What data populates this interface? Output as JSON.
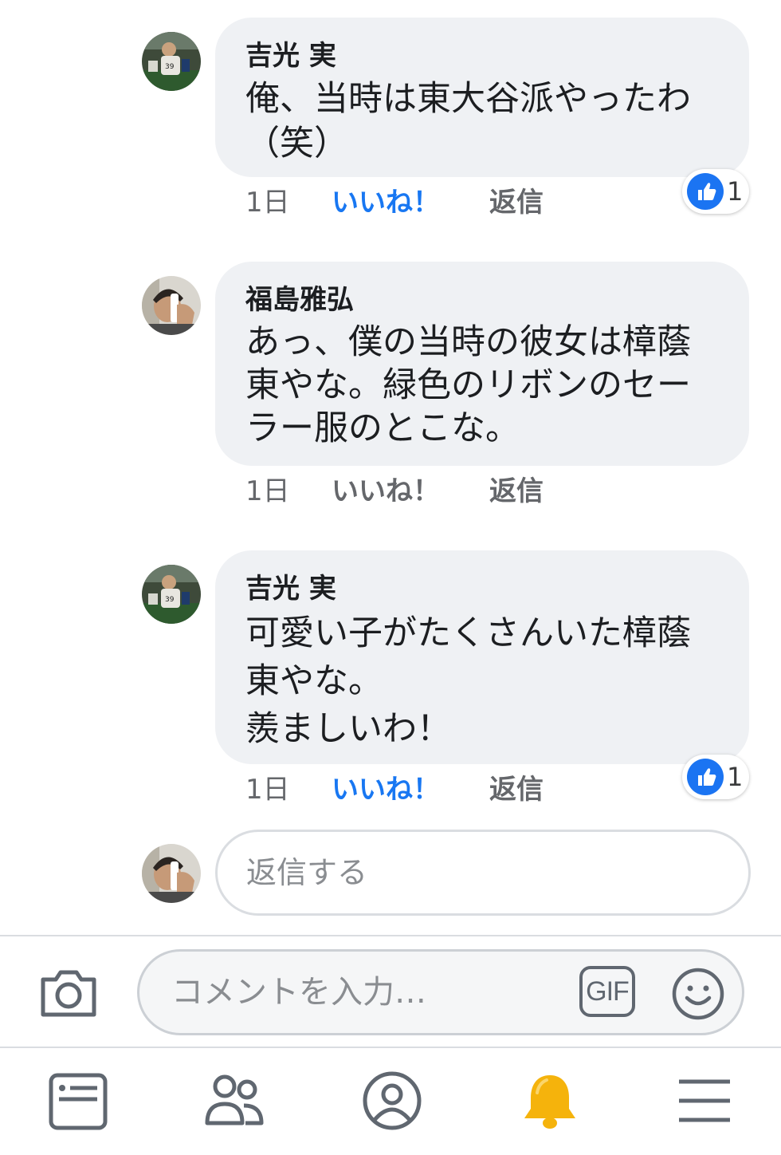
{
  "comments": [
    {
      "author": "吉光 実",
      "lines": [
        "俺、当時は東大谷派やったわ",
        "（笑）"
      ],
      "time": "1日",
      "like_label": "いいね！",
      "reply_label": "返信",
      "liked": true,
      "reaction_count": "1"
    },
    {
      "author": "福島雅弘",
      "lines": [
        "あっ、僕の当時の彼女は樟蔭",
        "東やな。緑色のリボンのセー",
        "ラー服のとこな。"
      ],
      "time": "1日",
      "like_label": "いいね！",
      "reply_label": "返信",
      "liked": false
    },
    {
      "author": "吉光 実",
      "lines": [
        "可愛い子がたくさんいた樟蔭",
        "東やな。",
        "羨ましいわ！"
      ],
      "time": "1日",
      "like_label": "いいね！",
      "reply_label": "返信",
      "liked": true,
      "reaction_count": "1"
    }
  ],
  "reply_box": {
    "placeholder": "返信する"
  },
  "comment_bar": {
    "placeholder": "コメントを入力…",
    "gif_label": "GIF",
    "camera_icon": "camera-icon",
    "emoji_icon": "smiley-icon"
  },
  "bottom_nav": {
    "items": [
      "news-feed-icon",
      "friends-icon",
      "profile-icon",
      "notifications-bell-icon",
      "menu-icon"
    ],
    "active_color": "#f5b30c"
  },
  "colors": {
    "accent": "#1877f2",
    "bubble": "#eff1f4",
    "muted": "#65676b"
  }
}
